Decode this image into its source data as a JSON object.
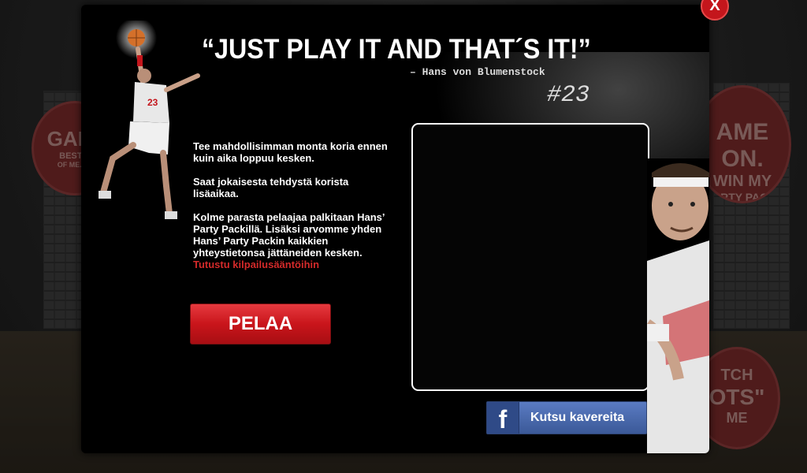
{
  "close_label": "X",
  "headline": {
    "quote": "“JUST PLAY IT AND THAT´S IT!”",
    "author": "– Hans von Blumenstock",
    "number": "#23"
  },
  "info": {
    "paragraph_1": "Tee mahdollisimman monta koria ennen kuin aika loppuu kesken.",
    "paragraph_2": "Saat jokaisesta tehdystä korista lisäaikaa.",
    "paragraph_3": "Kolme parasta pelaajaa palkitaan Hans’ Party Packillä. Lisäksi arvomme yhden Hans’ Party Packin kaikkien yhteystietonsa jättäneiden kesken.",
    "rules_link": "Tutustu kilpailusääntöihin"
  },
  "play_button": "PELAA",
  "facebook": {
    "icon_letter": "f",
    "label": "Kutsu kavereita"
  },
  "background": {
    "badge_left": [
      "GALL",
      "BEST P",
      "OF ME. WI"
    ],
    "badge_right_top": [
      "AME ON.",
      "WIN MY",
      "PARTY PACK."
    ],
    "badge_right_bottom": [
      "TCH",
      "OTS\"",
      "ME"
    ]
  },
  "colors": {
    "accent_red": "#c9151b",
    "facebook_blue": "#3b5998",
    "modal_bg": "#000000"
  },
  "icons": {
    "close": "close-icon",
    "facebook": "facebook-icon"
  }
}
